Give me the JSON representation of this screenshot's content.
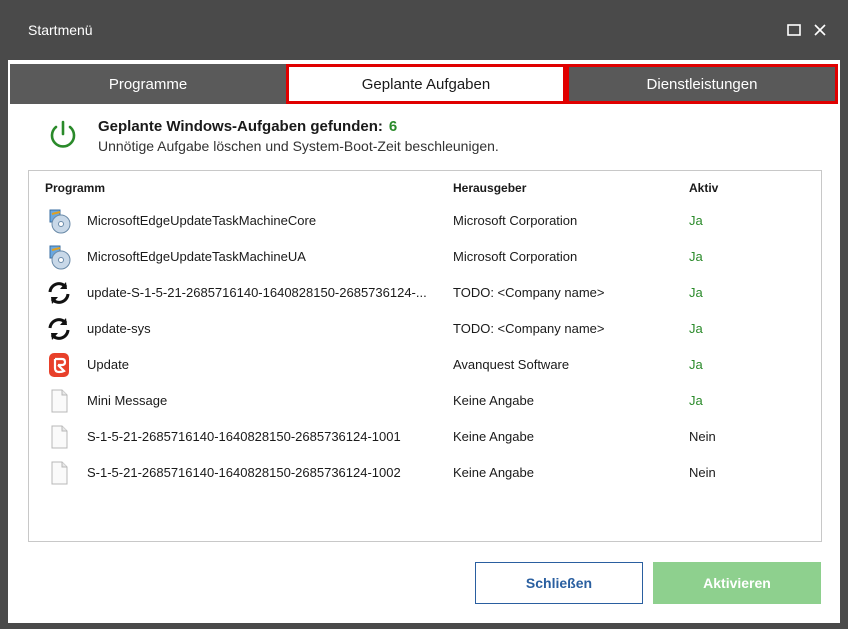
{
  "window": {
    "title": "Startmenü"
  },
  "tabs": [
    {
      "label": "Programme"
    },
    {
      "label": "Geplante Aufgaben"
    },
    {
      "label": "Dienstleistungen"
    }
  ],
  "header": {
    "title": "Geplante Windows-Aufgaben gefunden:",
    "count": "6",
    "subtitle": "Unnötige Aufgabe löschen und System-Boot-Zeit beschleunigen."
  },
  "table": {
    "columns": [
      "Programm",
      "Herausgeber",
      "Aktiv"
    ],
    "rows": [
      {
        "icon": "installer-disc-icon",
        "name": "MicrosoftEdgeUpdateTaskMachineCore",
        "publisher": "Microsoft Corporation",
        "active": "Ja"
      },
      {
        "icon": "installer-disc-icon",
        "name": "MicrosoftEdgeUpdateTaskMachineUA",
        "publisher": "Microsoft Corporation",
        "active": "Ja"
      },
      {
        "icon": "sync-arrows-icon",
        "name": "update-S-1-5-21-2685716140-1640828150-2685736124-...",
        "publisher": "TODO: <Company name>",
        "active": "Ja"
      },
      {
        "icon": "sync-arrows-icon",
        "name": "update-sys",
        "publisher": "TODO: <Company name>",
        "active": "Ja"
      },
      {
        "icon": "avanquest-logo-icon",
        "name": "Update",
        "publisher": "Avanquest Software",
        "active": "Ja"
      },
      {
        "icon": "blank-file-icon",
        "name": "Mini Message",
        "publisher": "Keine Angabe",
        "active": "Ja"
      },
      {
        "icon": "blank-file-icon",
        "name": "S-1-5-21-2685716140-1640828150-2685736124-1001",
        "publisher": "Keine Angabe",
        "active": "Nein"
      },
      {
        "icon": "blank-file-icon",
        "name": "S-1-5-21-2685716140-1640828150-2685736124-1002",
        "publisher": "Keine Angabe",
        "active": "Nein"
      }
    ]
  },
  "buttons": {
    "close_label": "Schließen",
    "activate_label": "Aktivieren"
  },
  "colors": {
    "accent_green": "#2a8a2a",
    "highlight_red": "#e00000",
    "button_blue": "#2a5fa0",
    "disabled_green": "#8ed08e"
  }
}
